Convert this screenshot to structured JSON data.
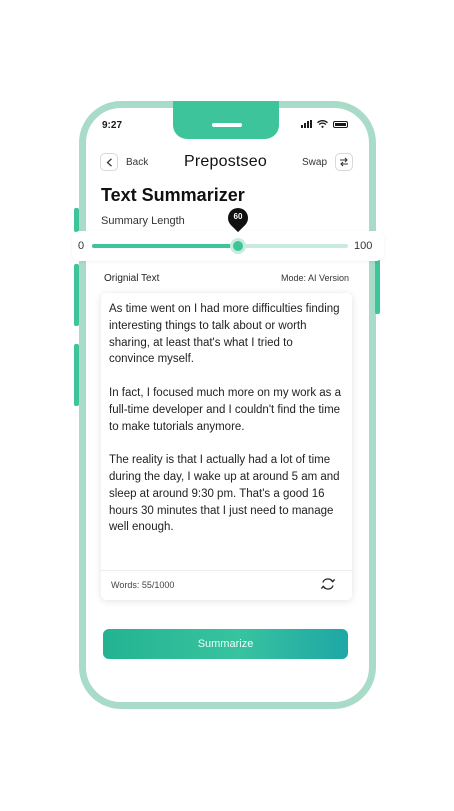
{
  "status_bar": {
    "time": "9:27"
  },
  "header": {
    "back_label": "Back",
    "app_title": "Prepostseo",
    "swap_label": "Swap"
  },
  "page": {
    "title": "Text Summarizer"
  },
  "slider": {
    "label": "Summary Length",
    "min_label": "0",
    "max_label": "100",
    "value": 60,
    "value_label": "60"
  },
  "editor": {
    "label": "Orignial Text",
    "mode": "Mode: AI Version",
    "text": "As time went on I had more difficulties finding interesting things to talk about or worth sharing, at least that's what I tried to convince myself.\n\nIn fact, I focused much more on my work as a full-time developer and I couldn't find the time to make tutorials anymore.\n\nThe reality is that I actually had a lot of time during the day, I wake up at around 5 am and sleep at around 9:30 pm. That's a good 16 hours 30 minutes that I just need to manage well enough.",
    "word_count": "Words: 55/1000"
  },
  "actions": {
    "summarize_label": "Summarize"
  },
  "colors": {
    "accent": "#3ec49a",
    "frame": "#a9dbc9",
    "track": "#c9ebde"
  },
  "icons": {
    "back": "chevron-left-icon",
    "swap": "swap-icon",
    "refresh": "refresh-icon"
  }
}
